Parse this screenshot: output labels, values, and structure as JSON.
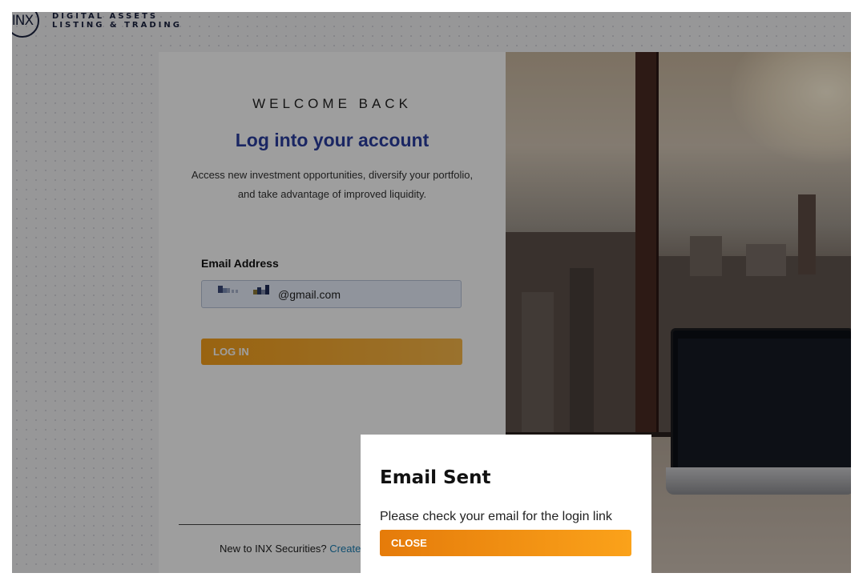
{
  "logo": {
    "mark": "INX",
    "line1": "DIGITAL ASSETS",
    "line2": "LISTING & TRADING"
  },
  "login": {
    "welcome": "WELCOME BACK",
    "title": "Log into your account",
    "subtitle": "Access new investment opportunities, diversify your portfolio, and take advantage of improved liquidity.",
    "email_label": "Email Address",
    "email_value": "@gmail.com",
    "login_button": "LOG IN",
    "signup_prompt": "New to INX Securities?",
    "signup_link": "Create a"
  },
  "modal": {
    "title": "Email Sent",
    "message": "Please check your email for the login link",
    "close_button": "CLOSE"
  },
  "colors": {
    "brand_blue": "#2b3ea0",
    "accent_orange": "#f7a11b",
    "link": "#1a7fb5"
  },
  "icons": {
    "logo": "inx-circle-logo"
  }
}
